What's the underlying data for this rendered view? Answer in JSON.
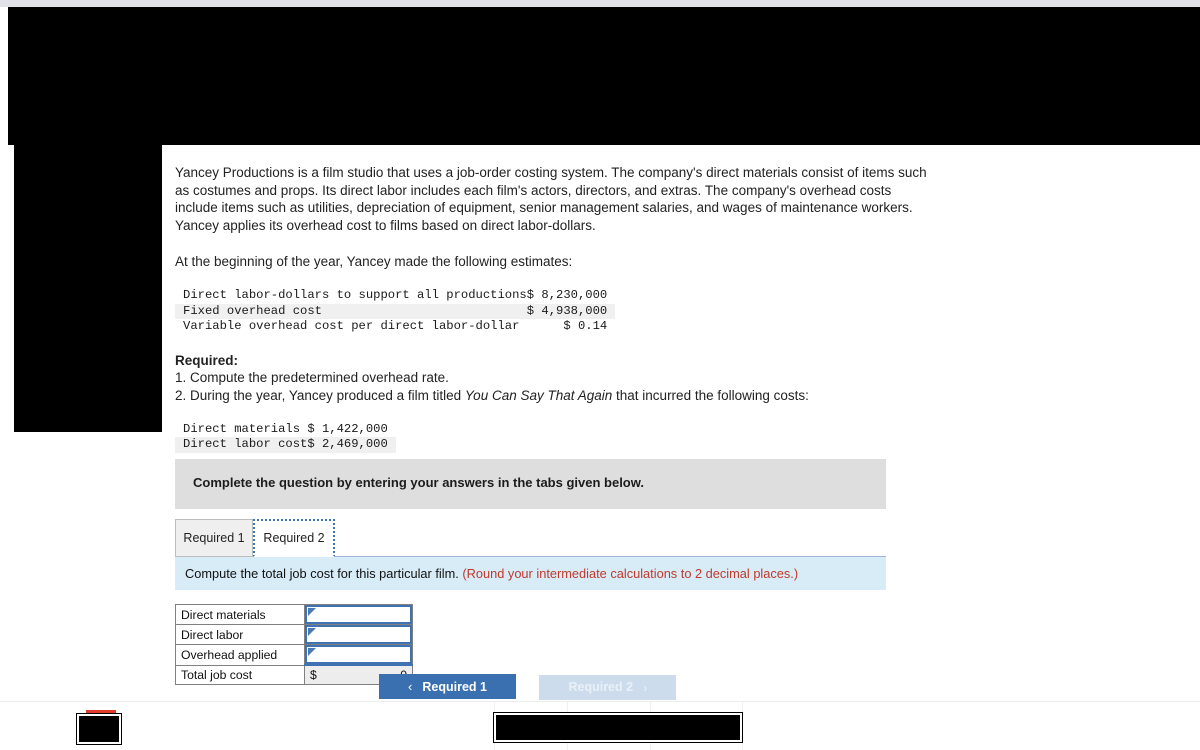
{
  "question": {
    "paragraphs": [
      "Yancey Productions is a film studio that uses a job-order costing system. The company's direct materials consist of items such as costumes and props. Its direct labor includes each film's actors, directors, and extras. The company's overhead costs include items such as utilities, depreciation of equipment, senior management salaries, and wages of maintenance workers. Yancey applies its overhead cost to films based on direct labor-dollars.",
      "At the beginning of the year, Yancey made the following estimates:"
    ],
    "estimates_table": {
      "rows": [
        {
          "label": "Direct labor-dollars to support all productions",
          "value": "$ 8,230,000"
        },
        {
          "label": "Fixed overhead cost",
          "value": "$ 4,938,000"
        },
        {
          "label": "Variable overhead cost per direct labor-dollar",
          "value": "$ 0.14"
        }
      ]
    },
    "required_heading": "Required:",
    "required_items": [
      "1. Compute the predetermined overhead rate.",
      "2. During the year, Yancey produced a film titled "
    ],
    "film_title": "You Can Say That Again",
    "required_item_2_tail": " that incurred the following costs:",
    "costs_table": {
      "rows": [
        {
          "label": "Direct materials",
          "value": "$ 1,422,000"
        },
        {
          "label": "Direct labor cost",
          "value": "$ 2,469,000"
        }
      ]
    },
    "closing_line": "Compute the total job cost for this particular film."
  },
  "widget": {
    "grey_banner": "Complete the question by entering your answers in the tabs given below.",
    "tabs": [
      {
        "label": "Required 1",
        "active": false
      },
      {
        "label": "Required 2",
        "active": true
      }
    ],
    "blue_bar": {
      "prompt": "Compute the total job cost for this particular film.",
      "note": "(Round your intermediate calculations to 2 decimal places.)"
    },
    "answer_rows": [
      {
        "label": "Direct materials",
        "value": ""
      },
      {
        "label": "Direct labor",
        "value": ""
      },
      {
        "label": "Overhead applied",
        "value": ""
      }
    ],
    "total_row": {
      "label": "Total job cost",
      "currency": "$",
      "value": "0"
    },
    "nav": {
      "prev": {
        "label": "Required 1",
        "chevron": "chevron-left-icon",
        "glyph": "‹"
      },
      "next": {
        "label": "Required 2",
        "chevron": "chevron-right-icon",
        "glyph": "›"
      }
    }
  },
  "colors": {
    "accent_blue": "#3a6fb0",
    "accent_blue_disabled": "#ccdcec",
    "banner_grey": "#dedede",
    "bar_blue": "#d8ecf8",
    "note_red": "#c0392b",
    "input_border": "#3f72b0",
    "redaction": "#000000",
    "red_marker": "#e03a2f"
  }
}
